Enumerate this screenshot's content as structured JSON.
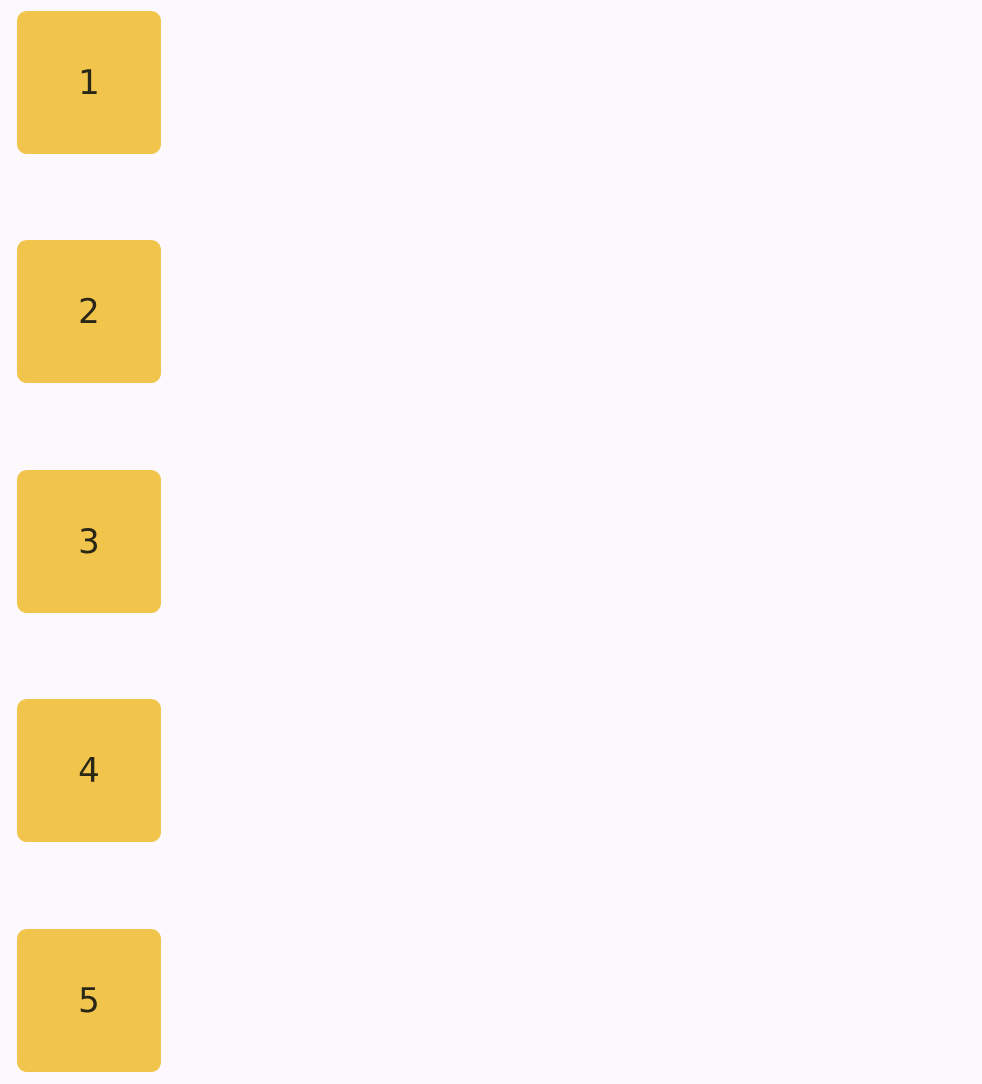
{
  "tiles": [
    {
      "label": "1"
    },
    {
      "label": "2"
    },
    {
      "label": "3"
    },
    {
      "label": "4"
    },
    {
      "label": "5"
    }
  ],
  "colors": {
    "background": "#fdf8fd",
    "tile": "#f1c54b",
    "tile_text": "#2a2618"
  }
}
